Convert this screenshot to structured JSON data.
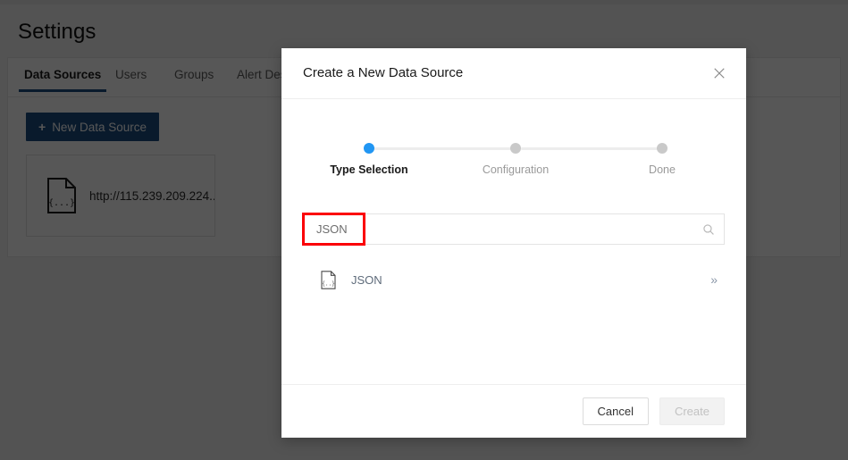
{
  "page": {
    "title": "Settings",
    "tabs": [
      {
        "label": "Data Sources",
        "active": true
      },
      {
        "label": "Users",
        "active": false
      },
      {
        "label": "Groups",
        "active": false
      },
      {
        "label": "Alert Des",
        "active": false
      }
    ],
    "new_data_source_button": "New Data Source",
    "plus_icon": "+",
    "data_sources": [
      {
        "label": "http://115.239.209.224...",
        "icon": "json-file-icon"
      }
    ]
  },
  "modal": {
    "title": "Create a New Data Source",
    "close_icon": "close-icon",
    "stepper": {
      "steps": [
        {
          "label": "Type Selection",
          "active": true
        },
        {
          "label": "Configuration",
          "active": false
        },
        {
          "label": "Done",
          "active": false
        }
      ],
      "active_color": "#2196f3",
      "inactive_color": "#c9c9c9"
    },
    "search": {
      "value": "JSON",
      "placeholder": "",
      "icon": "search-icon"
    },
    "annotation": {
      "color": "#fb0007"
    },
    "results": [
      {
        "label": "JSON",
        "icon": "json-file-icon",
        "chevron": "»"
      }
    ],
    "footer": {
      "cancel_label": "Cancel",
      "create_label": "Create"
    }
  },
  "colors": {
    "accent": "#1c4e80",
    "step_active": "#2196f3",
    "annotation": "#fb0007",
    "scrim": "rgba(0,0,0,0.66)"
  }
}
